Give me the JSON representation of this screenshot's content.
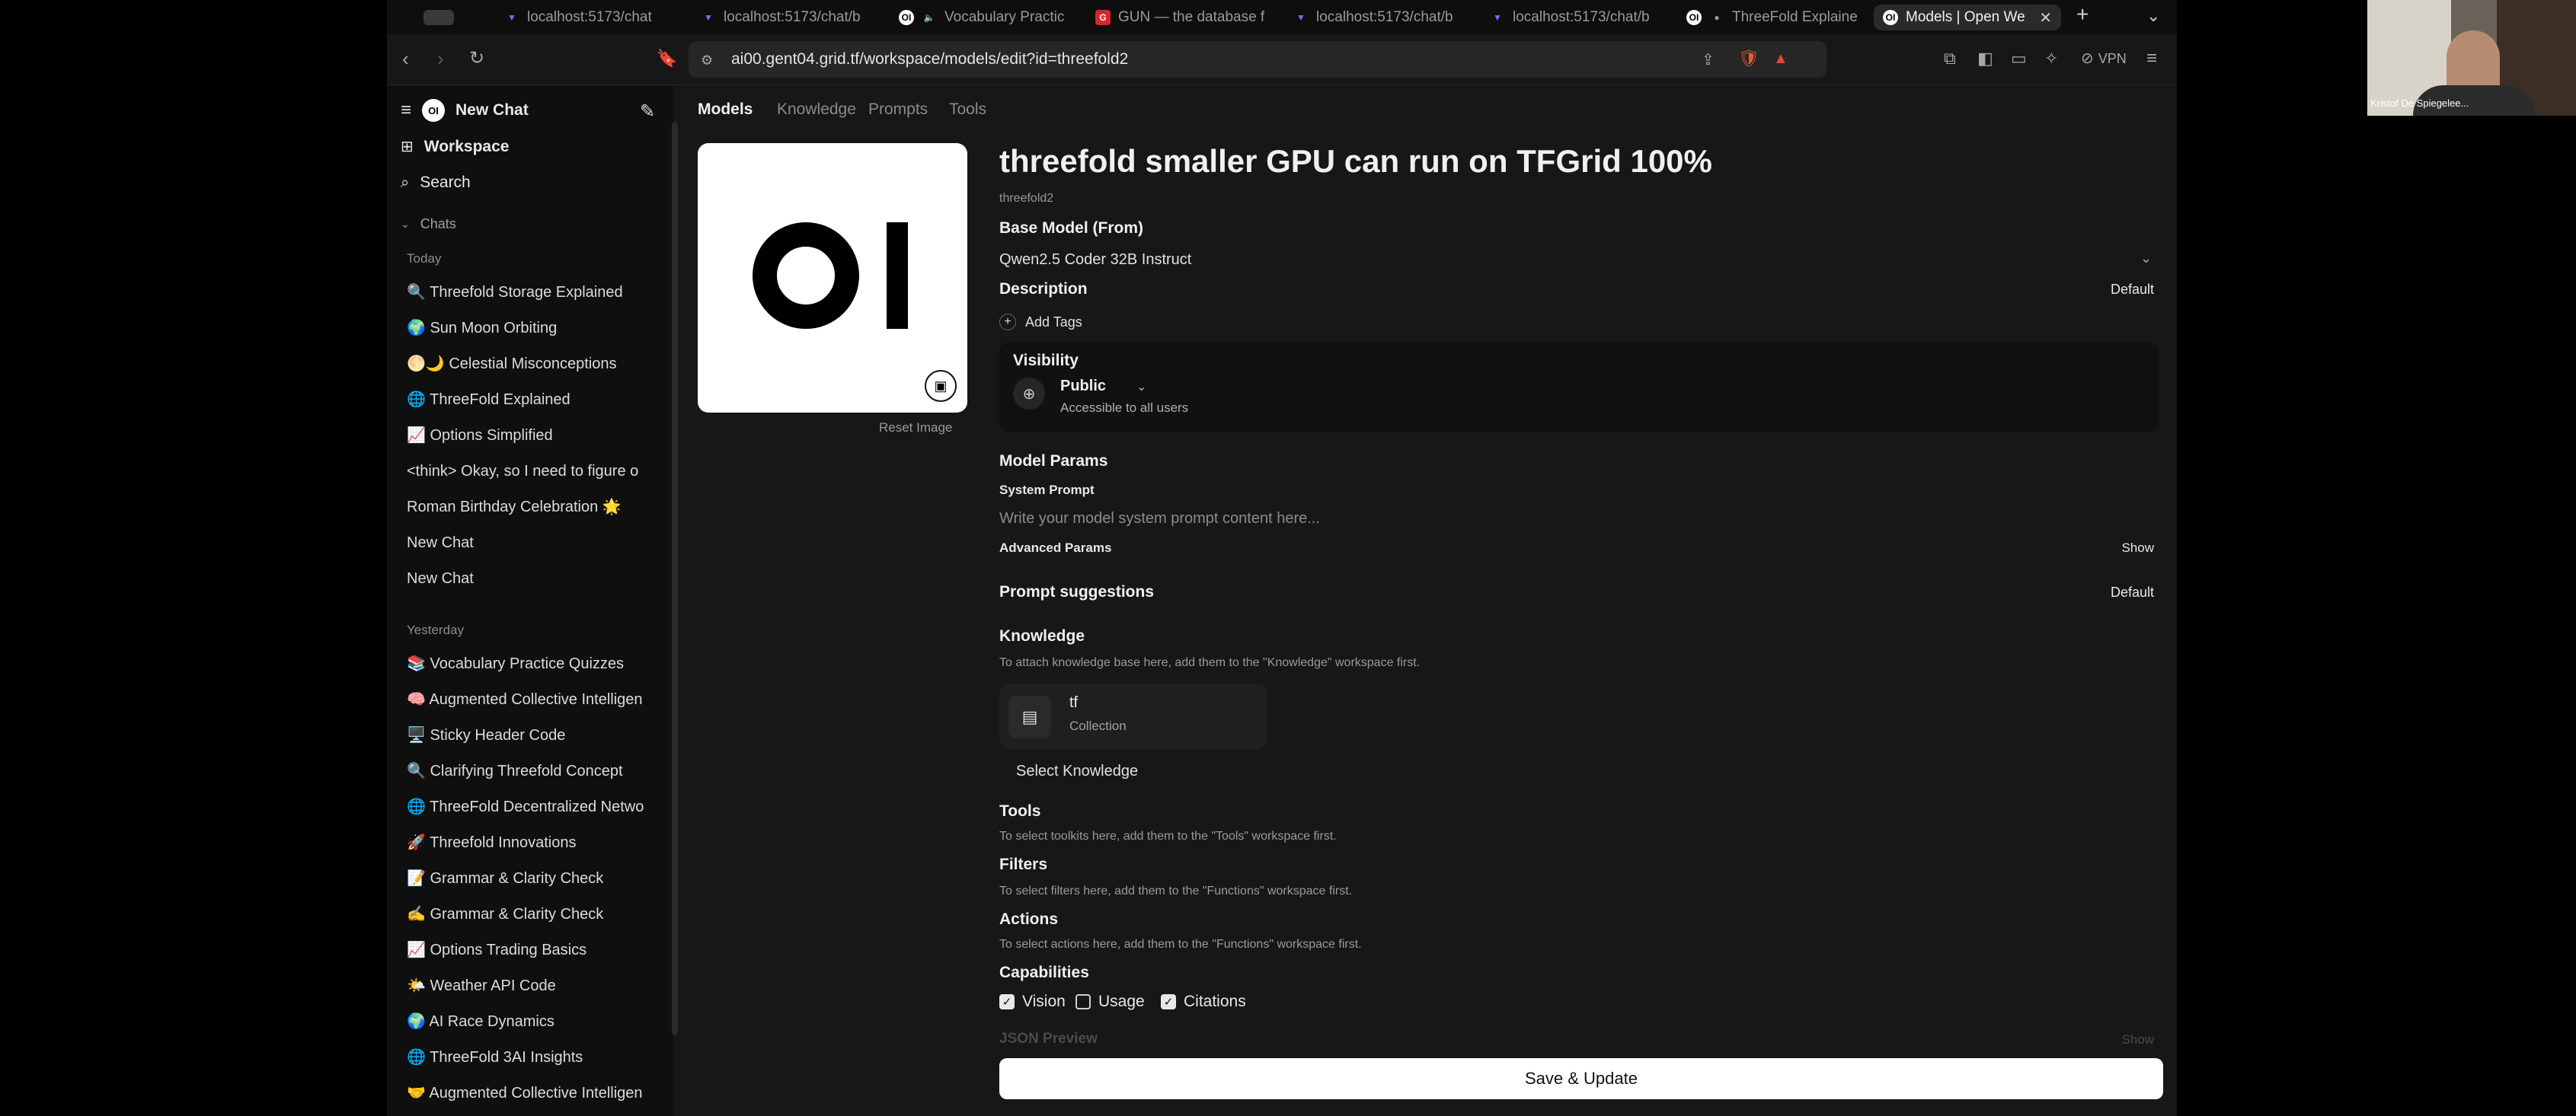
{
  "tabs": [
    {
      "title": "",
      "active": false
    },
    {
      "title": "localhost:5173/chat",
      "active": false
    },
    {
      "title": "localhost:5173/chat/b",
      "active": false
    },
    {
      "title": "Vocabulary Practic",
      "active": false
    },
    {
      "title": "GUN — the database f",
      "active": false
    },
    {
      "title": "localhost:5173/chat/b",
      "active": false
    },
    {
      "title": "localhost:5173/chat/b",
      "active": false
    },
    {
      "title": "ThreeFold Explaine",
      "active": false
    },
    {
      "title": "Models | Open We",
      "active": true
    }
  ],
  "toolbar": {
    "url": "ai00.gent04.grid.tf/workspace/models/edit?id=threefold2",
    "vpn_label": "VPN"
  },
  "sidebar": {
    "new_chat": "New Chat",
    "workspace": "Workspace",
    "search": "Search",
    "chats_header": "Chats",
    "today_label": "Today",
    "today": [
      "🔍 Threefold Storage Explained",
      "🌍 Sun Moon Orbiting",
      "🌕🌙 Celestial Misconceptions",
      "🌐 ThreeFold Explained",
      "📈 Options Simplified",
      "<think> Okay, so I need to figure o",
      "Roman Birthday Celebration 🌟",
      "New Chat",
      "New Chat"
    ],
    "yesterday_label": "Yesterday",
    "yesterday": [
      "📚 Vocabulary Practice Quizzes",
      "🧠 Augmented Collective Intelligen",
      "🖥️ Sticky Header Code",
      "🔍 Clarifying Threefold Concept",
      "🌐 ThreeFold Decentralized Netwo",
      "🚀 Threefold Innovations",
      "📝 Grammar & Clarity Check",
      "✍️ Grammar & Clarity Check",
      "📈 Options Trading Basics",
      "🌤️ Weather API Code",
      "🌍 AI Race Dynamics",
      "🌐 ThreeFold 3AI Insights",
      "🤝 Augmented Collective Intelligen"
    ]
  },
  "nav": {
    "models": "Models",
    "knowledge": "Knowledge",
    "prompts": "Prompts",
    "tools": "Tools"
  },
  "model": {
    "logo_text": "OI",
    "reset_image": "Reset Image",
    "name": "threefold smaller GPU can run on TFGrid 100%",
    "id": "threefold2",
    "base_model_label": "Base Model (From)",
    "base_model_value": "Qwen2.5 Coder 32B Instruct",
    "description_label": "Description",
    "description_default": "Default",
    "add_tags": "Add Tags",
    "visibility_label": "Visibility",
    "visibility_value": "Public",
    "visibility_desc": "Accessible to all users",
    "model_params_label": "Model Params",
    "system_prompt_label": "System Prompt",
    "system_prompt_placeholder": "Write your model system prompt content here...",
    "advanced_params_label": "Advanced Params",
    "advanced_params_toggle": "Show",
    "prompt_suggestions_label": "Prompt suggestions",
    "prompt_suggestions_default": "Default",
    "knowledge_label": "Knowledge",
    "knowledge_hint": "To attach knowledge base here, add them to the \"Knowledge\" workspace first.",
    "knowledge_item_name": "tf",
    "knowledge_item_type": "Collection",
    "select_knowledge": "Select Knowledge",
    "tools_label": "Tools",
    "tools_hint": "To select toolkits here, add them to the \"Tools\" workspace first.",
    "filters_label": "Filters",
    "filters_hint": "To select filters here, add them to the \"Functions\" workspace first.",
    "actions_label": "Actions",
    "actions_hint": "To select actions here, add them to the \"Functions\" workspace first.",
    "capabilities_label": "Capabilities",
    "capabilities": [
      {
        "label": "Vision",
        "checked": true
      },
      {
        "label": "Usage",
        "checked": false
      },
      {
        "label": "Citations",
        "checked": true
      }
    ],
    "json_preview_label": "JSON Preview",
    "json_preview_toggle": "Show",
    "save_button": "Save & Update"
  },
  "webcam": {
    "caption": "Kristof De Spiegelee..."
  }
}
